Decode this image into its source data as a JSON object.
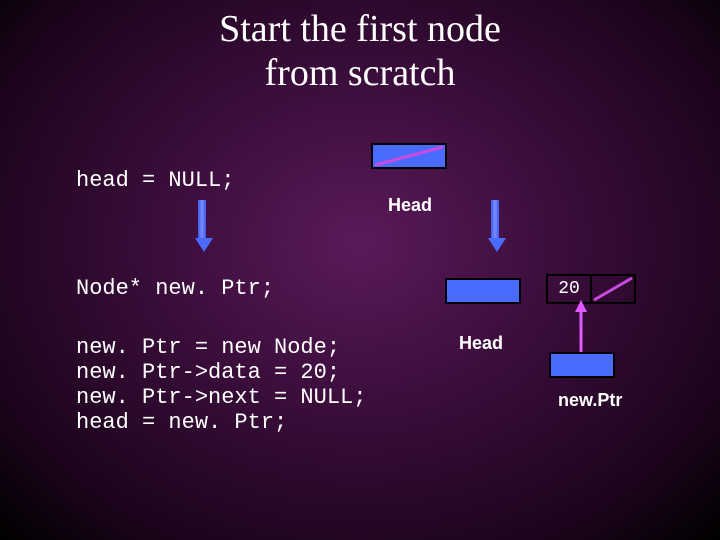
{
  "title_line1": "Start the first node",
  "title_line2": "from scratch",
  "code1": "head = NULL;",
  "code2": "Node* new. Ptr;",
  "code3": "new. Ptr = new Node;\nnew. Ptr->data = 20;\nnew. Ptr->next = NULL;\nhead = new. Ptr;",
  "label_head": "Head",
  "label_newptr": "new.Ptr",
  "node_value": "20"
}
